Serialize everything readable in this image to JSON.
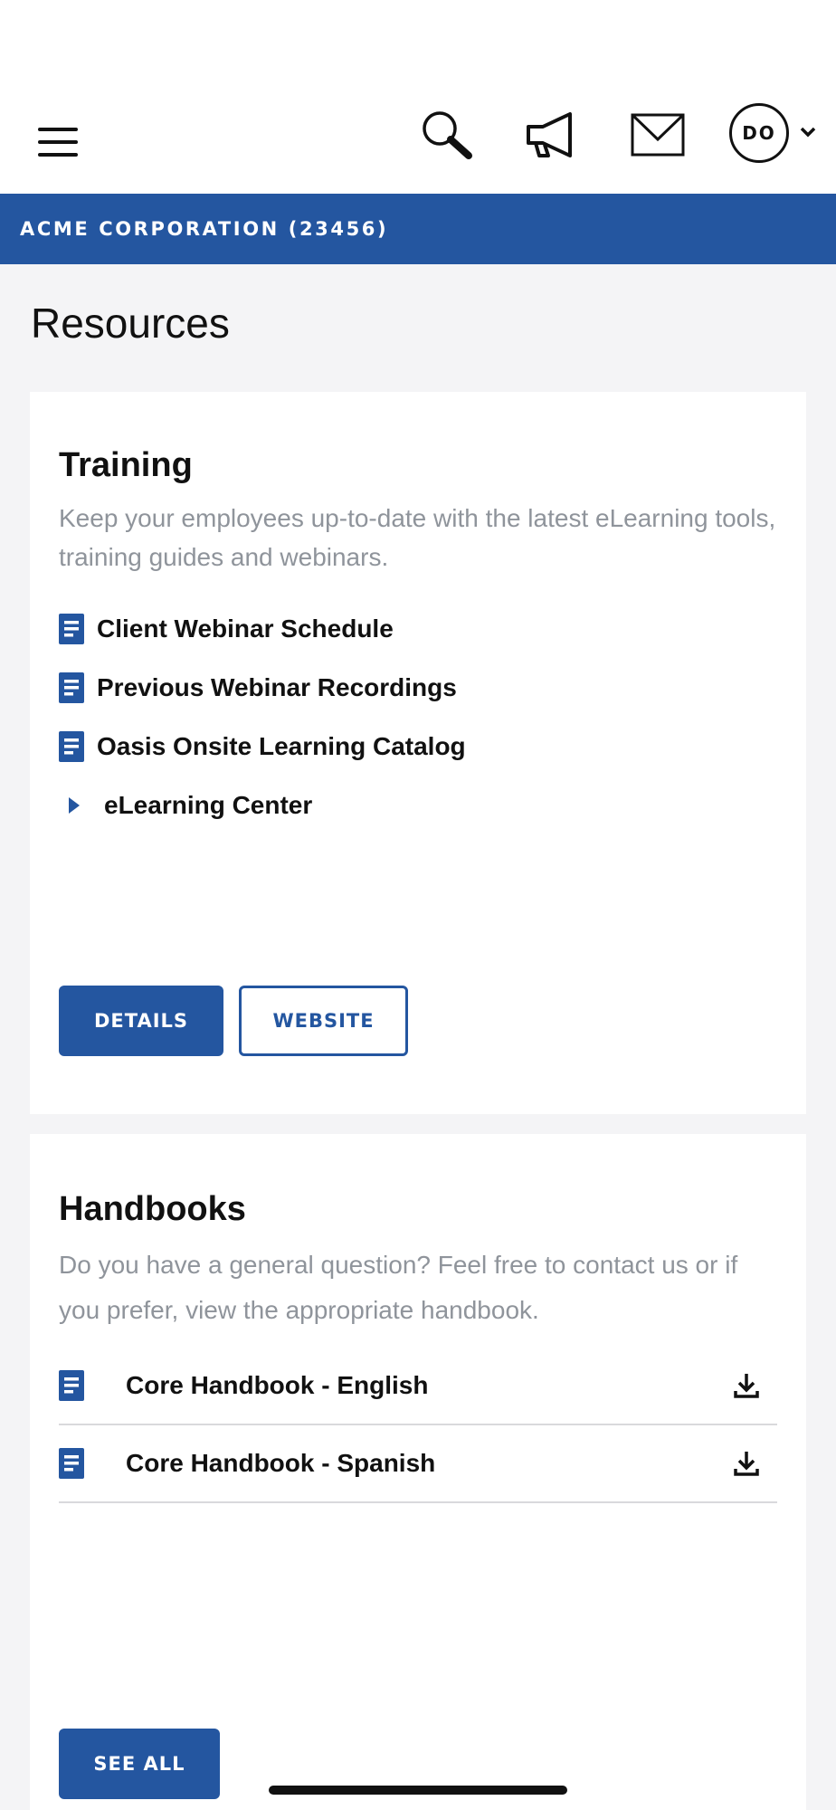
{
  "header": {
    "menu_icon": "hamburger-menu-icon",
    "search_icon": "search-icon",
    "announcements_icon": "megaphone-icon",
    "messages_icon": "mail-icon",
    "avatar_initials": "DO",
    "avatar_dropdown_icon": "chevron-down-icon"
  },
  "org_bar": {
    "label": "ACME CORPORATION (23456)"
  },
  "page": {
    "title": "Resources"
  },
  "training": {
    "title": "Training",
    "description": "Keep your employees up-to-date with the latest eLearning tools, training guides and webinars.",
    "links": [
      {
        "label": "Client Webinar Schedule",
        "icon": "document-icon"
      },
      {
        "label": "Previous Webinar Recordings",
        "icon": "document-icon"
      },
      {
        "label": "Oasis Onsite Learning Catalog",
        "icon": "document-icon"
      },
      {
        "label": "eLearning Center",
        "icon": "caret-right-icon"
      }
    ],
    "details_button": "DETAILS",
    "website_button": "WEBSITE"
  },
  "handbooks": {
    "title": "Handbooks",
    "description": "Do you have a general question? Feel free to contact us or if you prefer, view the appropriate handbook.",
    "items": [
      {
        "label": "Core Handbook - English",
        "icon": "document-icon",
        "action_icon": "download-icon"
      },
      {
        "label": "Core Handbook - Spanish",
        "icon": "document-icon",
        "action_icon": "download-icon"
      }
    ],
    "see_all_button": "SEE ALL"
  },
  "colors": {
    "brand_blue": "#2456a0",
    "muted_text": "#8f949b",
    "background": "#f4f4f6"
  }
}
